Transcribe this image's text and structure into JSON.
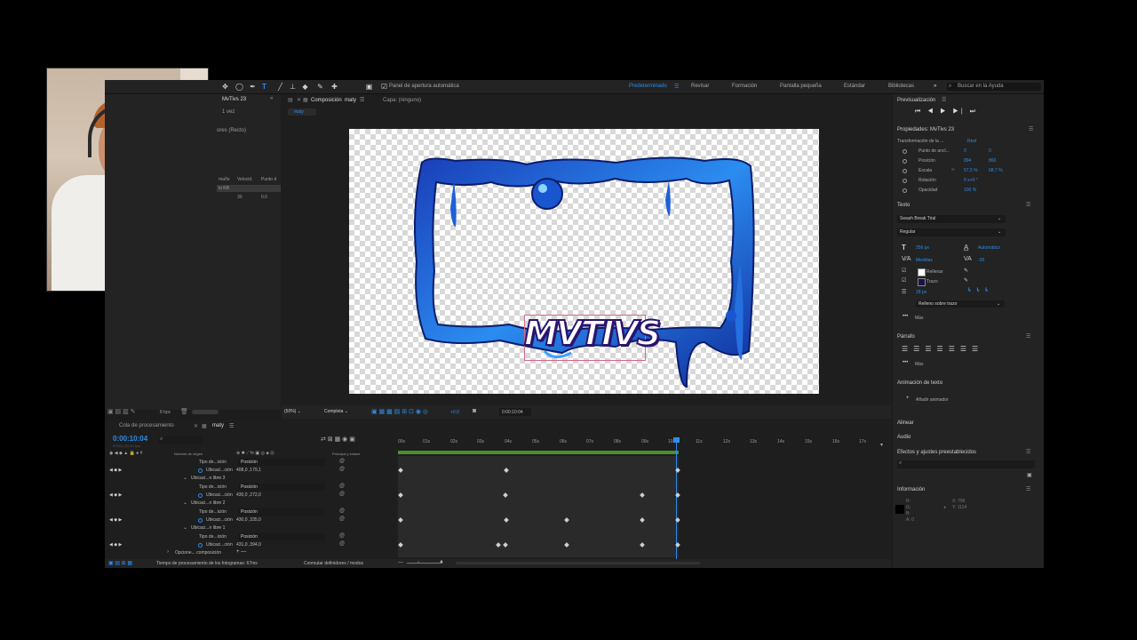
{
  "toolbar": {
    "auto_open_label": "Panel de apertura automática",
    "workspaces": [
      "Predeterminado",
      "Revisar",
      "Formación",
      "Pantalla pequeña",
      "Estándar",
      "Bibliotecas"
    ],
    "search_placeholder": "Buscar en la Ayuda"
  },
  "project": {
    "title": "MvTivs 23",
    "used": "1 vez",
    "type": "ores (Recto)",
    "col_size": "maño",
    "col_speed": "Velocid.",
    "col_point": "Punto d",
    "size_value": "lo KB",
    "speed_value": "30",
    "point_value": "0.0"
  },
  "comp": {
    "tab_label": "Composición",
    "tab_name": "maty",
    "layer_label": "Capa: (ninguno)",
    "subtab": "maty",
    "zoom": "(50%)",
    "quality": "Completa",
    "time": "0:00:10:04",
    "exposure": "+0,0"
  },
  "left_bottom": {
    "bpc": "8 bpc"
  },
  "timeline": {
    "queue_tab": "Cola de procesamiento",
    "comp_tab": "maty",
    "timecode": "0:00:10:04",
    "timecode_sub": "00304 (30.00 fps)",
    "col_source": "Nombre de origen",
    "col_parent": "Principal y enlace",
    "ruler": [
      "00s",
      "01s",
      "02s",
      "03s",
      "04s",
      "05s",
      "06s",
      "07s",
      "08s",
      "09s",
      "10s",
      "11s",
      "12s",
      "13s",
      "14s",
      "15s",
      "16s",
      "17s"
    ],
    "rows": [
      {
        "label": "Tipo de...ición",
        "value": "Posición"
      },
      {
        "label": "Ubicaci...ción",
        "value": "408,0 ,179,1"
      },
      {
        "label": "Ubicaci...n libre 3",
        "value": ""
      },
      {
        "label": "Tipo de...ición",
        "value": "Posición"
      },
      {
        "label": "Ubicaci...ción",
        "value": "430,0 ,272,0"
      },
      {
        "label": "Ubicaci...n libre 2",
        "value": ""
      },
      {
        "label": "Tipo de...ición",
        "value": "Posición"
      },
      {
        "label": "Ubicaci...ción",
        "value": "430,0 ,335,0"
      },
      {
        "label": "Ubicaci...n libre 1",
        "value": ""
      },
      {
        "label": "Tipo de...ición",
        "value": "Posición"
      },
      {
        "label": "Ubicaci...ción",
        "value": "431,0 ,394,0"
      },
      {
        "label": "Opcione... composición",
        "value": ""
      }
    ],
    "status": "Tiempo de procesamiento de los fotogramas: 67ms",
    "toggle": "Conmutar definidores / modos"
  },
  "right": {
    "preview_title": "Previsualización",
    "props_title": "Propiedades: MvTivs 23",
    "transform_label": "Transformación de la ...",
    "reset_label": "Rest",
    "props": [
      {
        "name": "Punto de ancl...",
        "v1": "0",
        "v2": "0"
      },
      {
        "name": "Posición",
        "v1": "894",
        "v2": "860"
      },
      {
        "name": "Escala",
        "v1": "57,5 %",
        "v2": "68,7 %"
      },
      {
        "name": "Rotación",
        "v1": "0 x+0 °",
        "v2": ""
      },
      {
        "name": "Opacidad",
        "v1": "100 %",
        "v2": ""
      }
    ],
    "text_title": "Texto",
    "font": "Swash Break Trial",
    "style": "Regular",
    "size": "256 px",
    "leading": "Automático",
    "kerning": "Medidas",
    "tracking": "-35",
    "fill_label": "Rellenar",
    "stroke_label": "Trazo",
    "stroke_size": "18 px",
    "stroke_mode": "Relleno sobre trazo",
    "more": "Más",
    "paragraph_title": "Párrafo",
    "anim_title": "Animación de texto",
    "add_anim": "Añadir animador",
    "align_title": "Alinear",
    "audio_title": "Audio",
    "effects_title": "Efectos y ajustes preestablecidos",
    "info_title": "Información",
    "info_rgb": [
      "R:",
      "G:",
      "B:",
      "A: 0"
    ],
    "info_x": "X: 796",
    "info_y": "Y: 1114"
  },
  "logo_text": "MVTIVS"
}
